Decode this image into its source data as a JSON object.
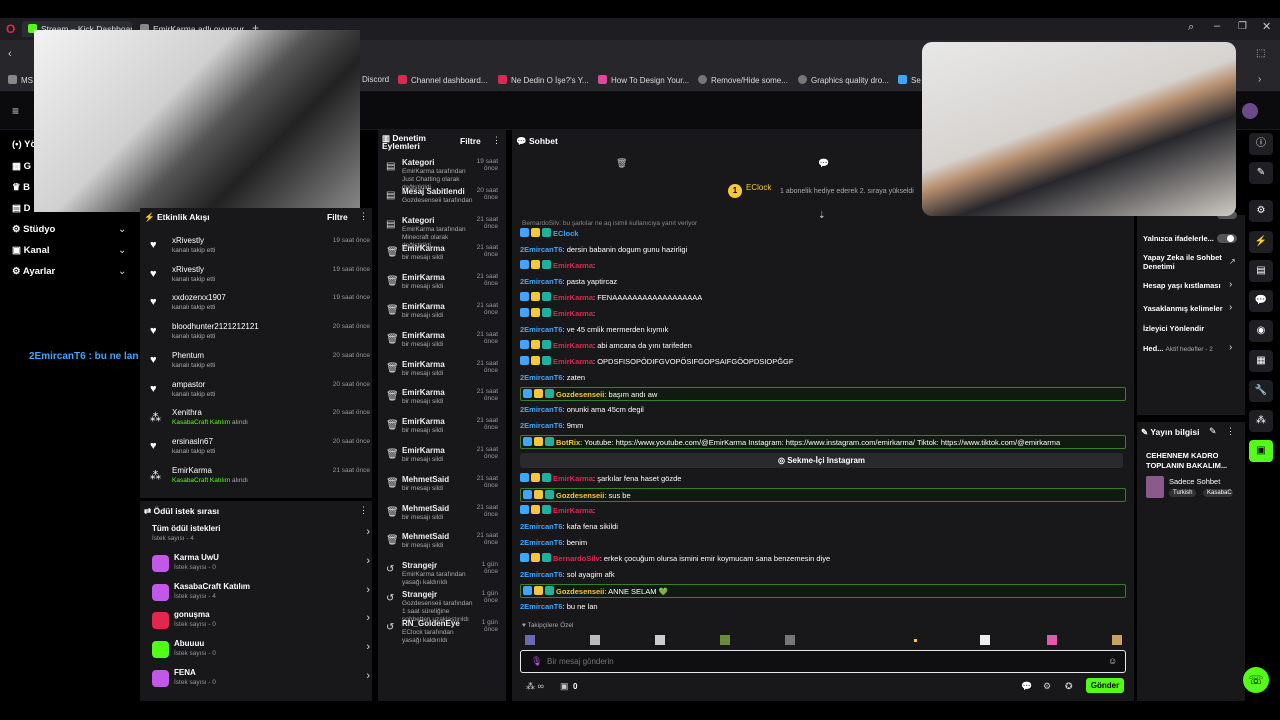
{
  "browser": {
    "tabs": [
      {
        "label": "Stream – Kick Dashboard"
      },
      {
        "label": "EmirKarma adlı oyuncunun..."
      }
    ],
    "bookmarks": [
      {
        "label": "MS"
      },
      {
        "label": "Discord"
      },
      {
        "label": "Channel dashboard..."
      },
      {
        "label": "Ne Dedin O İşe?'s Y..."
      },
      {
        "label": "How To Design Your..."
      },
      {
        "label": "Remove/Hide some..."
      },
      {
        "label": "Graphics quality dro..."
      },
      {
        "label": "Se"
      }
    ]
  },
  "nav": {
    "items": [
      {
        "label": "Yö"
      },
      {
        "label": "G"
      },
      {
        "label": "B"
      },
      {
        "label": "D"
      },
      {
        "label": "Stüdyo"
      },
      {
        "label": "Kanal"
      },
      {
        "label": "Ayarlar"
      }
    ],
    "overlay_text": "2EmircanT6 : bu ne lan"
  },
  "activity": {
    "title": "Etkinlik Akışı",
    "filter": "Filtre",
    "items": [
      {
        "name": "xRivestly",
        "sub": "kanalı takip etti",
        "time": "19 saat önce"
      },
      {
        "name": "xRivestly",
        "sub": "kanalı takip etti",
        "time": "19 saat önce"
      },
      {
        "name": "xxdozerxx1907",
        "sub": "kanalı takip etti",
        "time": "19 saat önce"
      },
      {
        "name": "bloodhunter2121212121",
        "sub": "kanalı takip etti",
        "time": "20 saat önce"
      },
      {
        "name": "Phentum",
        "sub": "kanalı takip etti",
        "time": "20 saat önce"
      },
      {
        "name": "ampastor",
        "sub": "kanalı takip etti",
        "time": "20 saat önce"
      },
      {
        "name": "Xenithra",
        "sub_green": "KasabaCraft Katılım",
        "sub": " alındı",
        "time": "20 saat önce"
      },
      {
        "name": "ersinasln67",
        "sub": "kanalı takip etti",
        "time": "20 saat önce"
      },
      {
        "name": "EmirKarma",
        "sub_green": "KasabaCraft Katılım",
        "sub": " alındı",
        "time": "21 saat önce"
      }
    ]
  },
  "rewards": {
    "title": "Ödül istek sırası",
    "items": [
      {
        "name": "Tüm ödül istekleri",
        "sub": "İstek sayısı - 4"
      },
      {
        "name": "Karma UwU",
        "sub": "İstek sayısı - 0",
        "color": "#c158e8"
      },
      {
        "name": "KasabaCraft Katılım",
        "sub": "İstek sayısı - 4",
        "color": "#c158e8"
      },
      {
        "name": "gonuşma",
        "sub": "İstek sayısı - 0",
        "color": "#e0284f"
      },
      {
        "name": "Abuuuu",
        "sub": "İstek sayısı - 0",
        "color": "#53fc18"
      },
      {
        "name": "FENA",
        "sub": "İstek sayısı - 0",
        "color": "#c158e8"
      }
    ]
  },
  "modlog": {
    "title": "Denetim Eylemleri",
    "filter": "Filtre",
    "items": [
      {
        "name": "Kategori",
        "sub": "EmirKarma tarafından Just Chatting olarak değiştirildi",
        "time": "19 saat önce"
      },
      {
        "name": "Mesaj Sabitlendi",
        "sub": "Gozdesenseii tarafından",
        "time": "20 saat önce"
      },
      {
        "name": "Kategori",
        "sub": "EmirKarma tarafından Minecraft olarak değiştirildi",
        "time": "21 saat önce"
      },
      {
        "name": "EmirKarma",
        "sub": "bir mesajı sildi",
        "time": "21 saat önce"
      },
      {
        "name": "EmirKarma",
        "sub": "bir mesajı sildi",
        "time": "21 saat önce"
      },
      {
        "name": "EmirKarma",
        "sub": "bir mesajı sildi",
        "time": "21 saat önce"
      },
      {
        "name": "EmirKarma",
        "sub": "bir mesajı sildi",
        "time": "21 saat önce"
      },
      {
        "name": "EmirKarma",
        "sub": "bir mesajı sildi",
        "time": "21 saat önce"
      },
      {
        "name": "EmirKarma",
        "sub": "bir mesajı sildi",
        "time": "21 saat önce"
      },
      {
        "name": "EmirKarma",
        "sub": "bir mesajı sildi",
        "time": "21 saat önce"
      },
      {
        "name": "EmirKarma",
        "sub": "bir mesajı sildi",
        "time": "21 saat önce"
      },
      {
        "name": "MehmetSaid",
        "sub": "bir mesajı sildi",
        "time": "21 saat önce"
      },
      {
        "name": "MehmetSaid",
        "sub": "bir mesajı sildi",
        "time": "21 saat önce"
      },
      {
        "name": "MehmetSaid",
        "sub": "bir mesajı sildi",
        "time": "21 saat önce"
      },
      {
        "name": "Strangejr",
        "sub": "EmirKarma tarafından yasağı kaldırıldı",
        "time": "1 gün önce"
      },
      {
        "name": "Strangejr",
        "sub": "Gozdesenseii tarafından 1 saat süreliğine sohbetten uzaklaştırıldı",
        "time": "1 gün önce"
      },
      {
        "name": "RN_GoldenEye",
        "sub": "EClock tarafından yasağı kaldırıldı",
        "time": "1 gün önce"
      }
    ]
  },
  "chat": {
    "title": "Sohbet",
    "pinned_user": "EClock",
    "pinned_count": "1",
    "pinned_text": "1 abonelik hediye ederek 2. sıraya yükseldi",
    "reply_hint": "BernardoSilv: bu şarkılar ne aq isimli kullanıcıya yanıt veriyor",
    "messages": [
      {
        "user": "EClock",
        "text": "",
        "color": "u-blue"
      },
      {
        "user": "2EmircanT6",
        "text": ": dersin babanin dogum gunu hazirligi",
        "color": "u-blue"
      },
      {
        "user": "EmirKarma",
        "text": ":",
        "color": "u-red"
      },
      {
        "user": "2EmircanT6",
        "text": ": pasta yaptircaz",
        "color": "u-blue"
      },
      {
        "user": "EmirKarma",
        "text": ": FENAAAAAAAAAAAAAAAAAA",
        "color": "u-red"
      },
      {
        "user": "EmirKarma",
        "text": ":",
        "color": "u-red"
      },
      {
        "user": "2EmircanT6",
        "text": ": ve 45 cmlik mermerden kıymık",
        "color": "u-blue"
      },
      {
        "user": "EmirKarma",
        "text": ": abi amcana da yını tarifeden",
        "color": "u-red"
      },
      {
        "user": "EmirKarma",
        "text": ": OPDSFISOPÖDIFGVOPÖSIFGOPSAIFGÖOPDSIOPĞGF",
        "color": "u-red"
      },
      {
        "user": "2EmircanT6",
        "text": ": zaten",
        "color": "u-blue"
      },
      {
        "user": "Gozdesenseii",
        "text": ": başım andı aw",
        "color": "u-gold",
        "hl": true
      },
      {
        "user": "2EmircanT6",
        "text": ": onunki ama 45cm degil",
        "color": "u-blue"
      },
      {
        "user": "2EmircanT6",
        "text": ": 9mm",
        "color": "u-blue"
      },
      {
        "user": "BotRix",
        "text": ": Youtube: https://www.youtube.com/@EmirKarma Instagram: https://www.instagram.com/emirkarma/ Tiktok: https://www.tiktok.com/@emirkarma",
        "color": "u-gold",
        "hl": true
      },
      {
        "user": "EmirKarma",
        "text": ": şarkılar fena haset gözde",
        "color": "u-red"
      },
      {
        "user": "Gozdesenseii",
        "text": ": sus be",
        "color": "u-gold",
        "hl": true
      },
      {
        "user": "EmirKarma",
        "text": ":",
        "color": "u-red"
      },
      {
        "user": "2EmircanT6",
        "text": ": kafa fena sikildi",
        "color": "u-blue"
      },
      {
        "user": "2EmircanT6",
        "text": ": benim",
        "color": "u-blue"
      },
      {
        "user": "BernardoSilv",
        "text": ": erkek çocuğum olursa ismini emir koymucam sana benzemesin diye",
        "color": "u-red"
      },
      {
        "user": "2EmircanT6",
        "text": ": sol ayagim afk",
        "color": "u-blue"
      },
      {
        "user": "Gozdesenseii",
        "text": ": ANNE SELAM 💚",
        "color": "u-gold",
        "hl": true
      },
      {
        "user": "2EmircanT6",
        "text": ": bu ne lan",
        "color": "u-blue"
      }
    ],
    "instagram_button": "Sekme-İçi Instagram",
    "followers_label": "Takipçilere Özel",
    "input_placeholder": "Bir mesaj gönderin",
    "send_label": "Gönder",
    "points": "0"
  },
  "settings": {
    "items": [
      {
        "label": "Yalnızca ifadelerle..."
      },
      {
        "label": "Yapay Zeka ile Sohbet Denetimi"
      },
      {
        "label": "Hesap yaşı kıstlaması"
      },
      {
        "label": "Yasaklanmış kelimeler"
      },
      {
        "label": "İzleyici Yönlendir"
      },
      {
        "label": "Hed...",
        "extra": "Aktif hedefler - 2"
      }
    ]
  },
  "stream_info": {
    "title": "Yayın bilgisi",
    "stream_title": "CEHENNEM KADRO TOPLANIN BAKALIM...",
    "category": "Sadece Sohbet",
    "tags": [
      "Turkish",
      "KasabaC"
    ]
  },
  "colors": {
    "kick_green": "#53fc18",
    "panel_bg": "#18181b",
    "page_bg": "#000000"
  }
}
